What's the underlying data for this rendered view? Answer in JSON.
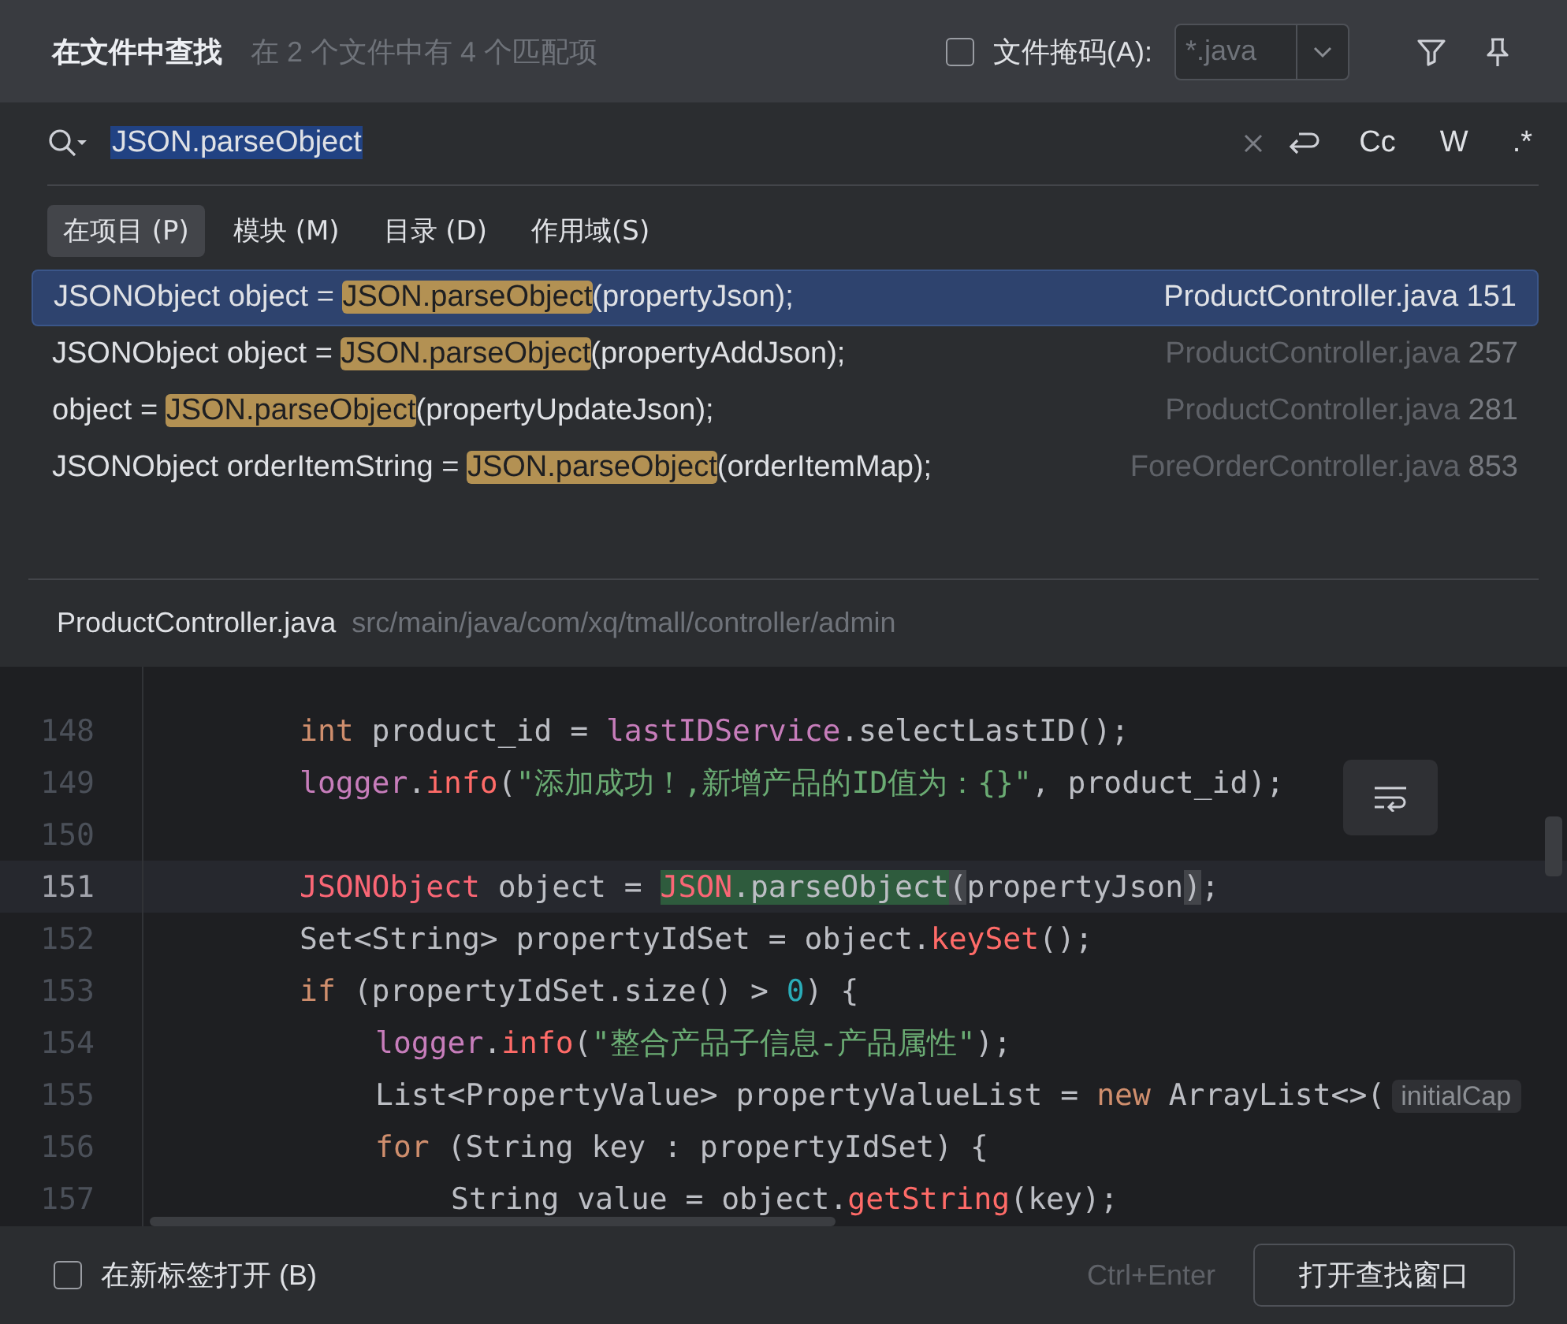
{
  "dialog": {
    "title": "在文件中查找",
    "summary": "在 2 个文件中有 4 个匹配项",
    "file_mask": {
      "label": "文件掩码(A):",
      "checked": false,
      "placeholder": "*.java"
    }
  },
  "search": {
    "value": "JSON.parseObject",
    "options": [
      {
        "label": "Cc",
        "on": false
      },
      {
        "label": "W",
        "on": false
      },
      {
        "label": ".*",
        "on": false
      }
    ]
  },
  "scopes": [
    {
      "label": "在项目 (P)",
      "selected": true
    },
    {
      "label": "模块 (M)",
      "selected": false
    },
    {
      "label": "目录 (D)",
      "selected": false
    },
    {
      "label": "作用域(S)",
      "selected": false
    }
  ],
  "results": [
    {
      "before": "JSONObject object = ",
      "match": "JSON.parseObject",
      "after": "(propertyJson);",
      "file": "ProductController.java",
      "line": "151",
      "selected": true
    },
    {
      "before": "JSONObject object = ",
      "match": "JSON.parseObject",
      "after": "(propertyAddJson);",
      "file": "ProductController.java",
      "line": "257",
      "selected": false
    },
    {
      "before": "object = ",
      "match": "JSON.parseObject",
      "after": "(propertyUpdateJson);",
      "file": "ProductController.java",
      "line": "281",
      "selected": false
    },
    {
      "before": "JSONObject orderItemString = ",
      "match": "JSON.parseObject",
      "after": "(orderItemMap);",
      "file": "ForeOrderController.java",
      "line": "853",
      "selected": false
    }
  ],
  "preview": {
    "file": "ProductController.java",
    "path": "src/main/java/com/xq/tmall/controller/admin",
    "lines": [
      {
        "number": "148",
        "current": false,
        "tokens": [
          {
            "t": "int",
            "kind": "kw"
          },
          {
            "t": " product_id = "
          },
          {
            "t": "lastIDService",
            "kind": "field"
          },
          {
            "t": ".selectLastID();"
          }
        ]
      },
      {
        "number": "149",
        "current": false,
        "tokens": [
          {
            "t": "logger",
            "kind": "field"
          },
          {
            "t": "."
          },
          {
            "t": "info",
            "kind": "method"
          },
          {
            "t": "("
          },
          {
            "t": "\"添加成功！,新增产品的ID值为：{}\"",
            "kind": "str"
          },
          {
            "t": ", product_id);"
          }
        ]
      },
      {
        "number": "150",
        "current": false
      },
      {
        "number": "151",
        "current": true,
        "tokens": [
          {
            "t": "JSONObject",
            "kind": "error"
          },
          {
            "t": " object = "
          },
          {
            "t": "JSON",
            "kind": "error",
            "match": true
          },
          {
            "t": ".parseObject",
            "match": true
          },
          {
            "t": "(",
            "brace": true
          },
          {
            "t": "propertyJson"
          },
          {
            "t": ")",
            "brace": true
          },
          {
            "t": ";"
          }
        ]
      },
      {
        "number": "152",
        "current": false,
        "tokens": [
          {
            "t": "Set<String> propertyIdSet = object."
          },
          {
            "t": "keySet",
            "kind": "method"
          },
          {
            "t": "();"
          }
        ]
      },
      {
        "number": "153",
        "current": false,
        "tokens": [
          {
            "t": "if",
            "kind": "kw"
          },
          {
            "t": " (propertyIdSet.size() > "
          },
          {
            "t": "0",
            "kind": "num"
          },
          {
            "t": ") {"
          }
        ],
        "children": [
          {
            "number": "154",
            "current": false,
            "tokens": [
              {
                "t": "logger",
                "kind": "field"
              },
              {
                "t": "."
              },
              {
                "t": "info",
                "kind": "method"
              },
              {
                "t": "("
              },
              {
                "t": "\"整合产品子信息-产品属性\"",
                "kind": "str"
              },
              {
                "t": ");"
              }
            ]
          },
          {
            "number": "155",
            "current": false,
            "tokens": [
              {
                "t": "List<PropertyValue> propertyValueList = "
              },
              {
                "t": "new",
                "kind": "kw"
              },
              {
                "t": " ArrayList<>("
              },
              {
                "t": "initialCap",
                "kind": "hint"
              }
            ]
          },
          {
            "number": "156",
            "current": false,
            "tokens": [
              {
                "t": "for",
                "kind": "kw"
              },
              {
                "t": " (String key : propertyIdSet) {"
              }
            ],
            "children": [
              {
                "number": "157",
                "current": false,
                "tokens": [
                  {
                    "t": "String value = object."
                  },
                  {
                    "t": "getString",
                    "kind": "method"
                  },
                  {
                    "t": "(key);"
                  }
                ]
              }
            ]
          }
        ]
      }
    ]
  },
  "footer": {
    "new_tab": {
      "label": "在新标签打开 (B)",
      "checked": false
    },
    "shortcut": "Ctrl+Enter",
    "open_button": "打开查找窗口"
  }
}
